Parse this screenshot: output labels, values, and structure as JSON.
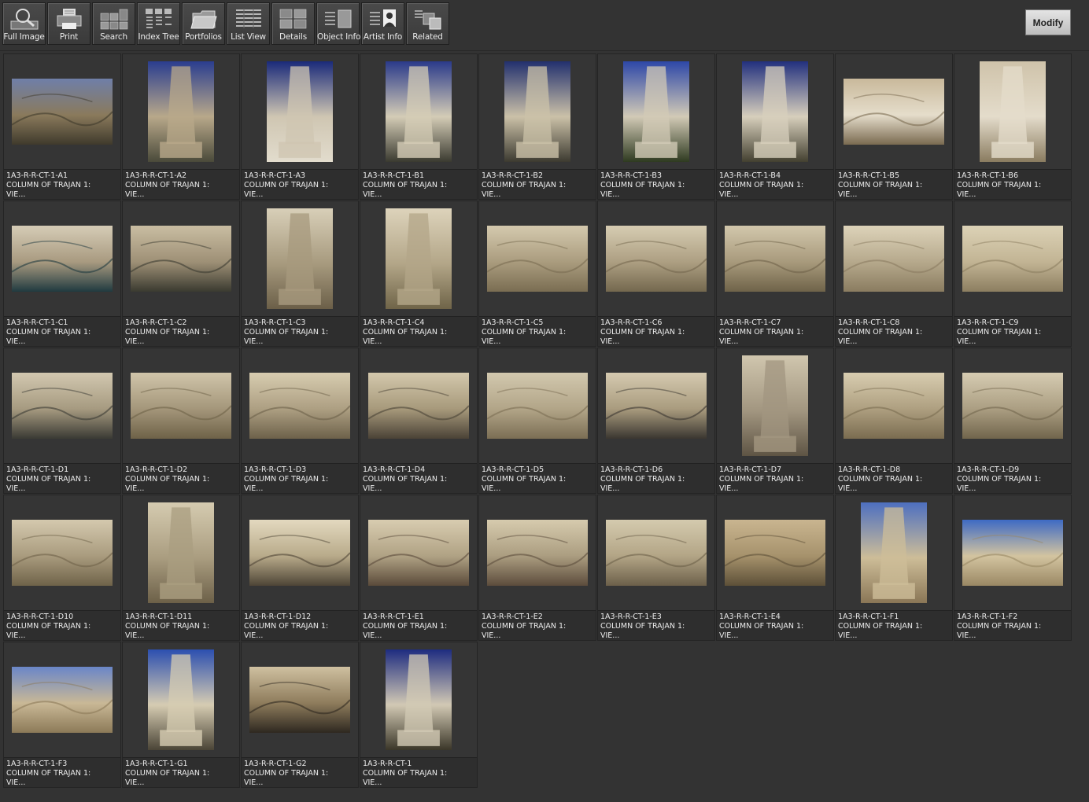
{
  "toolbar": {
    "buttons": [
      {
        "label": "Full Image",
        "icon": "magnifier-icon"
      },
      {
        "label": "Print",
        "icon": "printer-icon"
      },
      {
        "label": "Search",
        "icon": "search-grid-icon"
      },
      {
        "label": "Index Tree",
        "icon": "index-tree-icon"
      },
      {
        "label": "Portfolios",
        "icon": "folder-icon"
      },
      {
        "label": "List View",
        "icon": "list-view-icon"
      },
      {
        "label": "Details",
        "icon": "details-grid-icon"
      },
      {
        "label": "Object Info",
        "icon": "object-info-icon"
      },
      {
        "label": "Artist  Info",
        "icon": "artist-info-icon"
      },
      {
        "label": "Related",
        "icon": "related-icon"
      }
    ]
  },
  "modify_label": "Modify",
  "colors": {
    "background": "#333333",
    "caption_text": "#ececec",
    "button_face": "#cfcfcf"
  },
  "items": [
    {
      "id": "1A3-R-R-CT-1-A1",
      "title": "COLUMN OF TRAJAN 1:",
      "sub": "VIE...",
      "orient": "landscape",
      "palette": [
        "#6f7fa8",
        "#8a7a5c",
        "#3f3a2c"
      ]
    },
    {
      "id": "1A3-R-R-CT-1-A2",
      "title": "COLUMN OF TRAJAN 1:",
      "sub": "VIE...",
      "orient": "portrait",
      "palette": [
        "#2a3d8f",
        "#b8a88a",
        "#4a4a3a"
      ]
    },
    {
      "id": "1A3-R-R-CT-1-A3",
      "title": "COLUMN OF TRAJAN 1:",
      "sub": "VIE...",
      "orient": "portrait",
      "palette": [
        "#1a2a7a",
        "#cfc6b2",
        "#e2dccd"
      ]
    },
    {
      "id": "1A3-R-R-CT-1-B1",
      "title": "COLUMN OF TRAJAN 1:",
      "sub": "VIE...",
      "orient": "portrait",
      "palette": [
        "#2a3a8a",
        "#d4ccb6",
        "#3a3a30"
      ]
    },
    {
      "id": "1A3-R-R-CT-1-B2",
      "title": "COLUMN OF TRAJAN 1:",
      "sub": "VIE...",
      "orient": "portrait",
      "palette": [
        "#22306e",
        "#cbc1a8",
        "#3c3a30"
      ]
    },
    {
      "id": "1A3-R-R-CT-1-B3",
      "title": "COLUMN OF TRAJAN 1:",
      "sub": "VIE...",
      "orient": "portrait",
      "palette": [
        "#2d47a8",
        "#d2cab6",
        "#2e3a20"
      ]
    },
    {
      "id": "1A3-R-R-CT-1-B4",
      "title": "COLUMN OF TRAJAN 1:",
      "sub": "VIE...",
      "orient": "portrait",
      "palette": [
        "#22307e",
        "#d7cfbc",
        "#434030"
      ]
    },
    {
      "id": "1A3-R-R-CT-1-B5",
      "title": "COLUMN OF TRAJAN 1:",
      "sub": "VIE...",
      "orient": "landscape",
      "palette": [
        "#c9b99b",
        "#e5ddcb",
        "#7a6a50"
      ]
    },
    {
      "id": "1A3-R-R-CT-1-B6",
      "title": "COLUMN OF TRAJAN 1:",
      "sub": "VIE...",
      "orient": "portrait",
      "palette": [
        "#cfc3aa",
        "#e4dccb",
        "#8a7c60"
      ]
    },
    {
      "id": "1A3-R-R-CT-1-C1",
      "title": "COLUMN OF TRAJAN 1:",
      "sub": "VIE...",
      "orient": "landscape",
      "palette": [
        "#d6ccb6",
        "#a89a80",
        "#203a40"
      ]
    },
    {
      "id": "1A3-R-R-CT-1-C2",
      "title": "COLUMN OF TRAJAN 1:",
      "sub": "VIE...",
      "orient": "landscape",
      "palette": [
        "#c9bda2",
        "#9e9076",
        "#3a3a30"
      ]
    },
    {
      "id": "1A3-R-R-CT-1-C3",
      "title": "COLUMN OF TRAJAN 1:",
      "sub": "VIE...",
      "orient": "portrait",
      "palette": [
        "#d8cfb8",
        "#a79a7e",
        "#6b5f48"
      ]
    },
    {
      "id": "1A3-R-R-CT-1-C4",
      "title": "COLUMN OF TRAJAN 1:",
      "sub": "VIE...",
      "orient": "portrait",
      "palette": [
        "#ddd3bb",
        "#b3a688",
        "#6f6448"
      ]
    },
    {
      "id": "1A3-R-R-CT-1-C5",
      "title": "COLUMN OF TRAJAN 1:",
      "sub": "VIE...",
      "orient": "landscape",
      "palette": [
        "#d4c9ae",
        "#aa9c7e",
        "#7a6d52"
      ]
    },
    {
      "id": "1A3-R-R-CT-1-C6",
      "title": "COLUMN OF TRAJAN 1:",
      "sub": "VIE...",
      "orient": "landscape",
      "palette": [
        "#d6ccb2",
        "#ad9f82",
        "#74684e"
      ]
    },
    {
      "id": "1A3-R-R-CT-1-C7",
      "title": "COLUMN OF TRAJAN 1:",
      "sub": "VIE...",
      "orient": "landscape",
      "palette": [
        "#d2c7ac",
        "#a89a7c",
        "#6f6349"
      ]
    },
    {
      "id": "1A3-R-R-CT-1-C8",
      "title": "COLUMN OF TRAJAN 1:",
      "sub": "VIE...",
      "orient": "landscape",
      "palette": [
        "#ddd3ba",
        "#b6a98c",
        "#8a7c60"
      ]
    },
    {
      "id": "1A3-R-R-CT-1-C9",
      "title": "COLUMN OF TRAJAN 1:",
      "sub": "VIE...",
      "orient": "landscape",
      "palette": [
        "#dcd2b6",
        "#c2b494",
        "#8c7e60"
      ]
    },
    {
      "id": "1A3-R-R-CT-1-D1",
      "title": "COLUMN OF TRAJAN 1:",
      "sub": "VIE...",
      "orient": "landscape",
      "palette": [
        "#d2c8b0",
        "#a69a80",
        "#3a3a34"
      ]
    },
    {
      "id": "1A3-R-R-CT-1-D2",
      "title": "COLUMN OF TRAJAN 1:",
      "sub": "VIE...",
      "orient": "landscape",
      "palette": [
        "#d0c5aa",
        "#a4967a",
        "#6e6248"
      ]
    },
    {
      "id": "1A3-R-R-CT-1-D3",
      "title": "COLUMN OF TRAJAN 1:",
      "sub": "VIE...",
      "orient": "landscape",
      "palette": [
        "#d7ccb0",
        "#ad9f82",
        "#6d614a"
      ]
    },
    {
      "id": "1A3-R-R-CT-1-D4",
      "title": "COLUMN OF TRAJAN 1:",
      "sub": "VIE...",
      "orient": "landscape",
      "palette": [
        "#d3c8ac",
        "#a7997b",
        "#4a4236"
      ]
    },
    {
      "id": "1A3-R-R-CT-1-D5",
      "title": "COLUMN OF TRAJAN 1:",
      "sub": "VIE...",
      "orient": "landscape",
      "palette": [
        "#d2c8ae",
        "#b2a588",
        "#7b6e54"
      ]
    },
    {
      "id": "1A3-R-R-CT-1-D6",
      "title": "COLUMN OF TRAJAN 1:",
      "sub": "VIE...",
      "orient": "landscape",
      "palette": [
        "#d5cab0",
        "#a99b7e",
        "#3a3630"
      ]
    },
    {
      "id": "1A3-R-R-CT-1-D7",
      "title": "COLUMN OF TRAJAN 1:",
      "sub": "VIE...",
      "orient": "portrait",
      "palette": [
        "#d0c6ae",
        "#a29680",
        "#5e5444"
      ]
    },
    {
      "id": "1A3-R-R-CT-1-D8",
      "title": "COLUMN OF TRAJAN 1:",
      "sub": "VIE...",
      "orient": "landscape",
      "palette": [
        "#d8cdb0",
        "#ae9f80",
        "#7a6c50"
      ]
    },
    {
      "id": "1A3-R-R-CT-1-D9",
      "title": "COLUMN OF TRAJAN 1:",
      "sub": "VIE...",
      "orient": "landscape",
      "palette": [
        "#d6ccb2",
        "#ab9e82",
        "#71654c"
      ]
    },
    {
      "id": "1A3-R-R-CT-1-D10",
      "title": "COLUMN OF TRAJAN 1:",
      "sub": "VIE...",
      "orient": "landscape",
      "palette": [
        "#d4c9ae",
        "#a99b7e",
        "#6f6349"
      ]
    },
    {
      "id": "1A3-R-R-CT-1-D11",
      "title": "COLUMN OF TRAJAN 1:",
      "sub": "VIE...",
      "orient": "portrait",
      "palette": [
        "#d5cbb0",
        "#aa9d80",
        "#6c6048"
      ]
    },
    {
      "id": "1A3-R-R-CT-1-D12",
      "title": "COLUMN OF TRAJAN 1:",
      "sub": "VIE...",
      "orient": "landscape",
      "palette": [
        "#e3d9bf",
        "#b8aa8a",
        "#4e4536"
      ]
    },
    {
      "id": "1A3-R-R-CT-1-E1",
      "title": "COLUMN OF TRAJAN 1:",
      "sub": "VIE...",
      "orient": "landscape",
      "palette": [
        "#d8ccb0",
        "#b0a284",
        "#5a4a3a"
      ]
    },
    {
      "id": "1A3-R-R-CT-1-E2",
      "title": "COLUMN OF TRAJAN 1:",
      "sub": "VIE...",
      "orient": "landscape",
      "palette": [
        "#d6cbae",
        "#ab9d80",
        "#5c4c3c"
      ]
    },
    {
      "id": "1A3-R-R-CT-1-E3",
      "title": "COLUMN OF TRAJAN 1:",
      "sub": "VIE...",
      "orient": "landscape",
      "palette": [
        "#d4caae",
        "#b3a586",
        "#6c604a"
      ]
    },
    {
      "id": "1A3-R-R-CT-1-E4",
      "title": "COLUMN OF TRAJAN 1:",
      "sub": "VIE...",
      "orient": "landscape",
      "palette": [
        "#c9b590",
        "#a6926c",
        "#5d5038"
      ]
    },
    {
      "id": "1A3-R-R-CT-1-F1",
      "title": "COLUMN OF TRAJAN 1:",
      "sub": "VIE...",
      "orient": "portrait",
      "palette": [
        "#4d6fc0",
        "#cdbd98",
        "#8a7656"
      ]
    },
    {
      "id": "1A3-R-R-CT-1-F2",
      "title": "COLUMN OF TRAJAN 1:",
      "sub": "VIE...",
      "orient": "landscape",
      "palette": [
        "#3e6ac4",
        "#d3c4a0",
        "#9a8864"
      ]
    },
    {
      "id": "1A3-R-R-CT-1-F3",
      "title": "COLUMN OF TRAJAN 1:",
      "sub": "VIE...",
      "orient": "landscape",
      "palette": [
        "#6a86c8",
        "#c9b896",
        "#8c7a58"
      ]
    },
    {
      "id": "1A3-R-R-CT-1-G1",
      "title": "COLUMN OF TRAJAN 1:",
      "sub": "VIE...",
      "orient": "portrait",
      "palette": [
        "#2c4fb0",
        "#d6ccb2",
        "#4a4436"
      ]
    },
    {
      "id": "1A3-R-R-CT-1-G2",
      "title": "COLUMN OF TRAJAN 1:",
      "sub": "VIE...",
      "orient": "landscape",
      "palette": [
        "#cfc0a0",
        "#8e7c5c",
        "#2e2820"
      ]
    },
    {
      "id": "1A3-R-R-CT-1",
      "title": "COLUMN OF TRAJAN 1:",
      "sub": "VIE...",
      "orient": "portrait",
      "palette": [
        "#1e2c80",
        "#d2c9b4",
        "#3a3628"
      ]
    }
  ]
}
